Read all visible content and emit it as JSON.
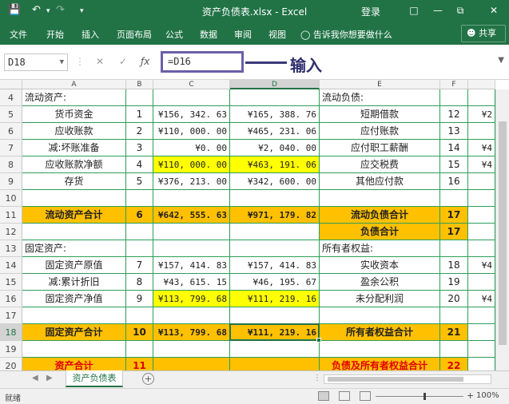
{
  "titlebar": {
    "save_icon": "save-icon",
    "undo_icon": "undo-icon",
    "redo_icon": "redo-icon",
    "title": "资产负债表.xlsx - Excel",
    "login": "登录"
  },
  "ribbon": {
    "tabs": [
      "文件",
      "开始",
      "插入",
      "页面布局",
      "公式",
      "数据",
      "审阅",
      "视图"
    ],
    "tell_me": "告诉我你想要做什么",
    "share": "共享"
  },
  "formula_bar": {
    "name_box": "D18",
    "formula": "=D16",
    "callout": "输入"
  },
  "columns": [
    "A",
    "B",
    "C",
    "D",
    "E",
    "F"
  ],
  "rows": [
    {
      "num": "4",
      "cells": [
        "流动资产:",
        "",
        "",
        "",
        "流动负债:",
        "",
        ""
      ]
    },
    {
      "num": "5",
      "cells": [
        "货币资金",
        "1",
        "¥156, 342. 63",
        "¥165, 388. 76",
        "短期借款",
        "12",
        "¥2"
      ]
    },
    {
      "num": "6",
      "cells": [
        "应收账款",
        "2",
        "¥110, 000. 00",
        "¥465, 231. 06",
        "应付账款",
        "13",
        ""
      ]
    },
    {
      "num": "7",
      "cells": [
        "减:坏账准备",
        "3",
        "¥0. 00",
        "¥2, 040. 00",
        "应付职工薪酬",
        "14",
        "¥4"
      ]
    },
    {
      "num": "8",
      "cells": [
        "应收账款净额",
        "4",
        "¥110, 000. 00",
        "¥463, 191. 06",
        "应交税费",
        "15",
        "¥4"
      ]
    },
    {
      "num": "9",
      "cells": [
        "存货",
        "5",
        "¥376, 213. 00",
        "¥342, 600. 00",
        "其他应付款",
        "16",
        ""
      ]
    },
    {
      "num": "10",
      "cells": [
        "",
        "",
        "",
        "",
        "",
        "",
        ""
      ]
    },
    {
      "num": "11",
      "cells": [
        "流动资产合计",
        "6",
        "¥642, 555. 63",
        "¥971, 179. 82",
        "流动负债合计",
        "17",
        ""
      ]
    },
    {
      "num": "12",
      "cells": [
        "",
        "",
        "",
        "",
        "负债合计",
        "17",
        ""
      ]
    },
    {
      "num": "13",
      "cells": [
        "固定资产:",
        "",
        "",
        "",
        "所有者权益:",
        "",
        ""
      ]
    },
    {
      "num": "14",
      "cells": [
        "固定资产原值",
        "7",
        "¥157, 414. 83",
        "¥157, 414. 83",
        "实收资本",
        "18",
        "¥4"
      ]
    },
    {
      "num": "15",
      "cells": [
        "减:累计折旧",
        "8",
        "¥43, 615. 15",
        "¥46, 195. 67",
        "盈余公积",
        "19",
        ""
      ]
    },
    {
      "num": "16",
      "cells": [
        "固定资产净值",
        "9",
        "¥113, 799. 68",
        "¥111, 219. 16",
        "未分配利润",
        "20",
        "¥4"
      ]
    },
    {
      "num": "17",
      "cells": [
        "",
        "",
        "",
        "",
        "",
        "",
        ""
      ]
    },
    {
      "num": "18",
      "cells": [
        "固定资产合计",
        "10",
        "¥113, 799. 68",
        "¥111, 219. 16",
        "所有者权益合计",
        "21",
        ""
      ]
    },
    {
      "num": "19",
      "cells": [
        "",
        "",
        "",
        "",
        "",
        "",
        ""
      ]
    },
    {
      "num": "20",
      "cells": [
        "资产合计",
        "11",
        "",
        "",
        "负债及所有者权益合计",
        "22",
        ""
      ]
    }
  ],
  "sheet_tab": "资产负债表",
  "status": {
    "ready": "就绪",
    "zoom": "100%"
  },
  "colors": {
    "excel_green": "#217346",
    "orange_fill": "#ffc000",
    "yellow_fill": "#ffff00",
    "red_text": "#e00000",
    "callout": "#6a5fa8"
  }
}
